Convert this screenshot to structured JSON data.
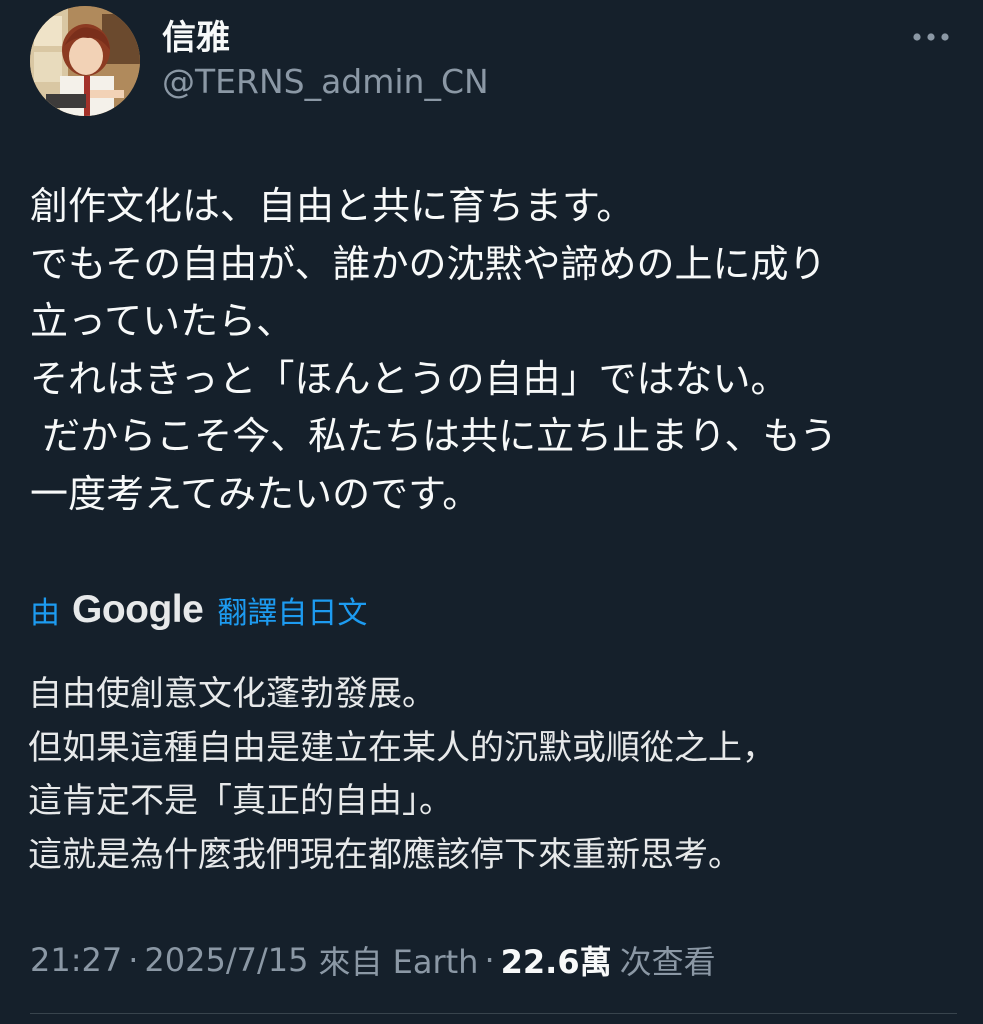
{
  "author": {
    "display_name": "信雅",
    "handle": "@TERNS_admin_CN"
  },
  "tweet": {
    "lines": [
      "創作文化は、自由と共に育ちます。",
      "でもその自由が、誰かの沈黙や諦めの上に成り",
      "立っていたら、",
      "それはきっと「ほんとうの自由」ではない。",
      " だからこそ今、私たちは共に立ち止まり、もう",
      "一度考えてみたいのです。"
    ]
  },
  "translation": {
    "by_label": "由",
    "provider": "Google",
    "from_label": "翻譯自日文",
    "lines": [
      "自由使創意文化蓬勃發展。",
      "但如果這種自由是建立在某人的沉默或順從之上，",
      "這肯定不是「真正的自由」。",
      "這就是為什麼我們現在都應該停下來重新思考。"
    ]
  },
  "meta": {
    "time": "21:27",
    "date": "2025/7/15",
    "source": "來自 Earth",
    "views_count": "22.6萬",
    "views_label": "次查看"
  },
  "colors": {
    "background": "#15202b",
    "text": "#e7e9ea",
    "secondary": "#8b98a5",
    "link": "#1d9bf0"
  },
  "icons": {
    "more": "more-horizontal-icon"
  }
}
